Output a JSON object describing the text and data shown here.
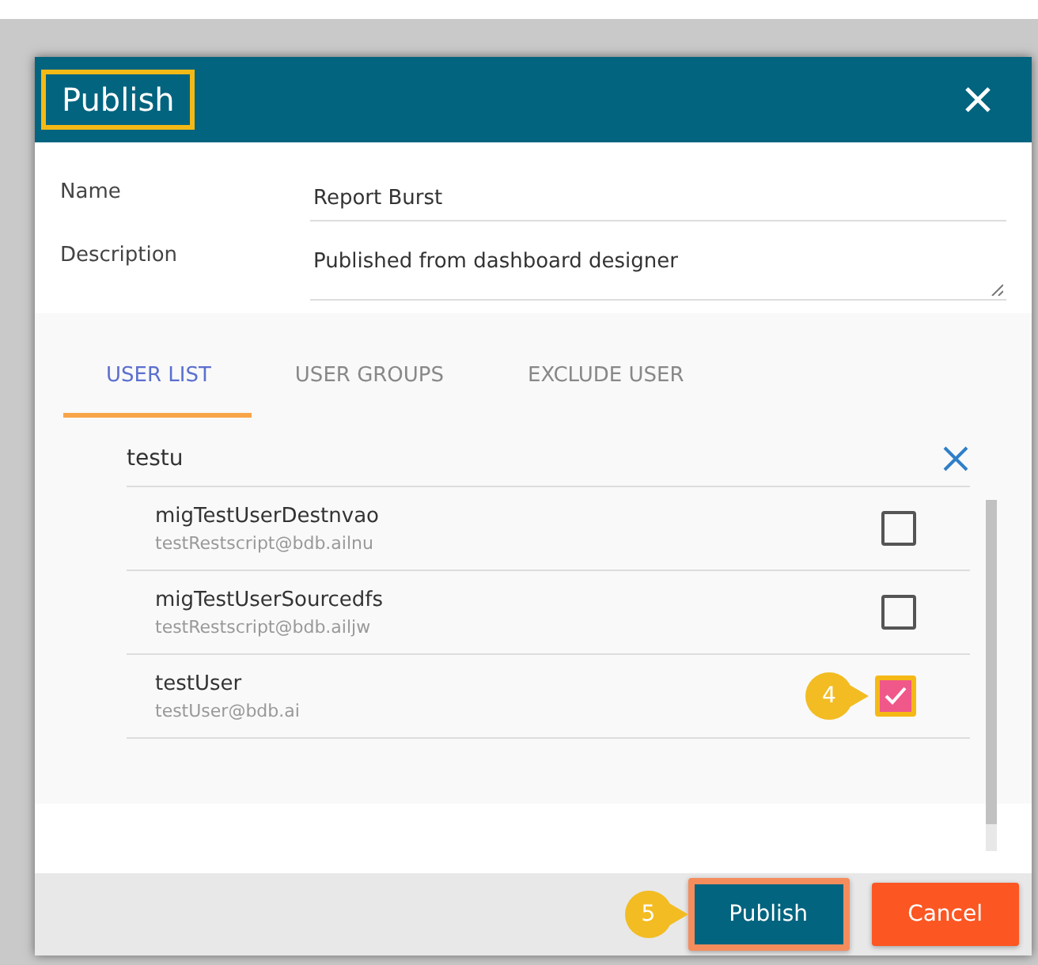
{
  "dialog": {
    "title": "Publish",
    "title_highlighted": true
  },
  "fields": [
    {
      "label": "Name",
      "value": "Report Burst",
      "kind": "input"
    },
    {
      "label": "Description",
      "value": "Published from dashboard designer",
      "kind": "textarea"
    }
  ],
  "tabs": [
    {
      "label": "USER LIST",
      "selected": true
    },
    {
      "label": "USER GROUPS",
      "selected": false
    },
    {
      "label": "EXCLUDE USER",
      "selected": false
    }
  ],
  "search": {
    "value": "testu"
  },
  "users": [
    {
      "name": "migTestUserDestnvao",
      "email": "testRestscript@bdb.ailnu",
      "checked": false
    },
    {
      "name": "migTestUserSourcedfs",
      "email": "testRestscript@bdb.ailjw",
      "checked": false
    },
    {
      "name": "testUser",
      "email": "testUser@bdb.ai",
      "checked": true,
      "callout": "4"
    }
  ],
  "buttons": [
    {
      "label": "Publish",
      "kind": "primary",
      "callout": "5",
      "highlighted": true
    },
    {
      "label": "Cancel",
      "kind": "danger",
      "highlighted": false
    }
  ]
}
